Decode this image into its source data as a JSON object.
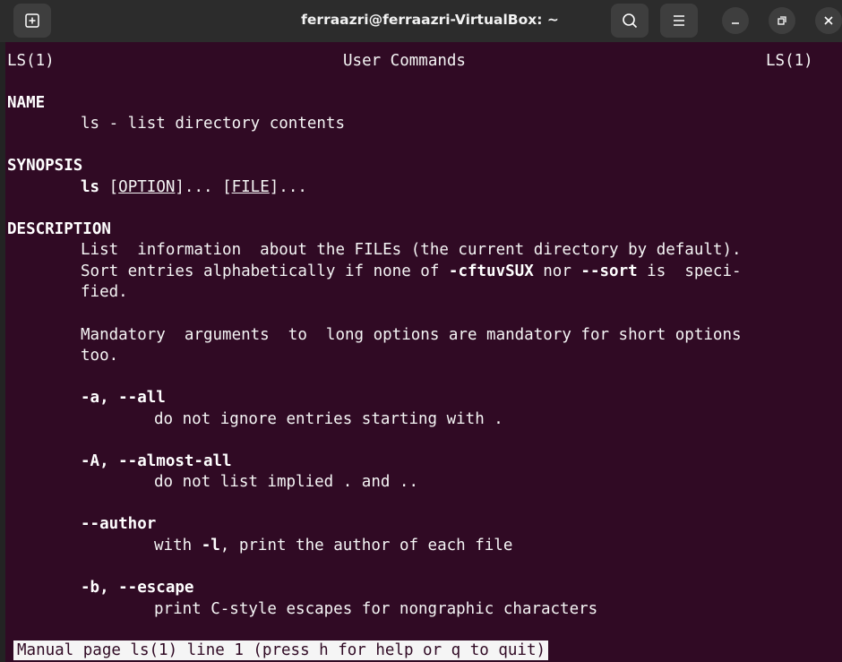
{
  "window": {
    "title": "ferraazri@ferraazri-VirtualBox: ~",
    "icons": {
      "new_tab": "new-tab-icon",
      "search": "search-icon",
      "menu": "hamburger-menu-icon",
      "minimize": "minimize-icon",
      "maximize": "restore-icon",
      "close": "close-icon"
    }
  },
  "man": {
    "header_left": "LS(1)",
    "header_center": "User Commands",
    "header_right": "LS(1)",
    "name_heading": "NAME",
    "name_text": "ls - list directory contents",
    "synopsis_heading": "SYNOPSIS",
    "synopsis_cmd": "ls",
    "synopsis_open1": "[",
    "synopsis_option": "OPTION",
    "synopsis_close1": "]... [",
    "synopsis_file": "FILE",
    "synopsis_close2": "]...",
    "description_heading": "DESCRIPTION",
    "desc_line1": "List  information  about the FILEs (the current directory by default).",
    "desc_line2_a": "Sort entries alphabetically if none of ",
    "desc_line2_b": "-cftuvSUX",
    "desc_line2_c": " nor ",
    "desc_line2_d": "--sort",
    "desc_line2_e": " is  speci-",
    "desc_line3": "fied.",
    "desc_line4": "Mandatory  arguments  to  long options are mandatory for short options",
    "desc_line5": "too.",
    "opt_a": "-a, --all",
    "opt_a_desc": "do not ignore entries starting with .",
    "opt_A": "-A, --almost-all",
    "opt_A_desc": "do not list implied . and ..",
    "opt_author": "--author",
    "opt_author_desc_a": "with ",
    "opt_author_desc_b": "-l",
    "opt_author_desc_c": ", print the author of each file",
    "opt_b": "-b, --escape",
    "opt_b_desc": "print C-style escapes for nongraphic characters"
  },
  "status_bar": "Manual page ls(1) line 1 (press h for help or q to quit)",
  "colors": {
    "terminal_bg": "#300a24",
    "titlebar_bg": "#2c2c2c",
    "text": "#ffffff"
  }
}
